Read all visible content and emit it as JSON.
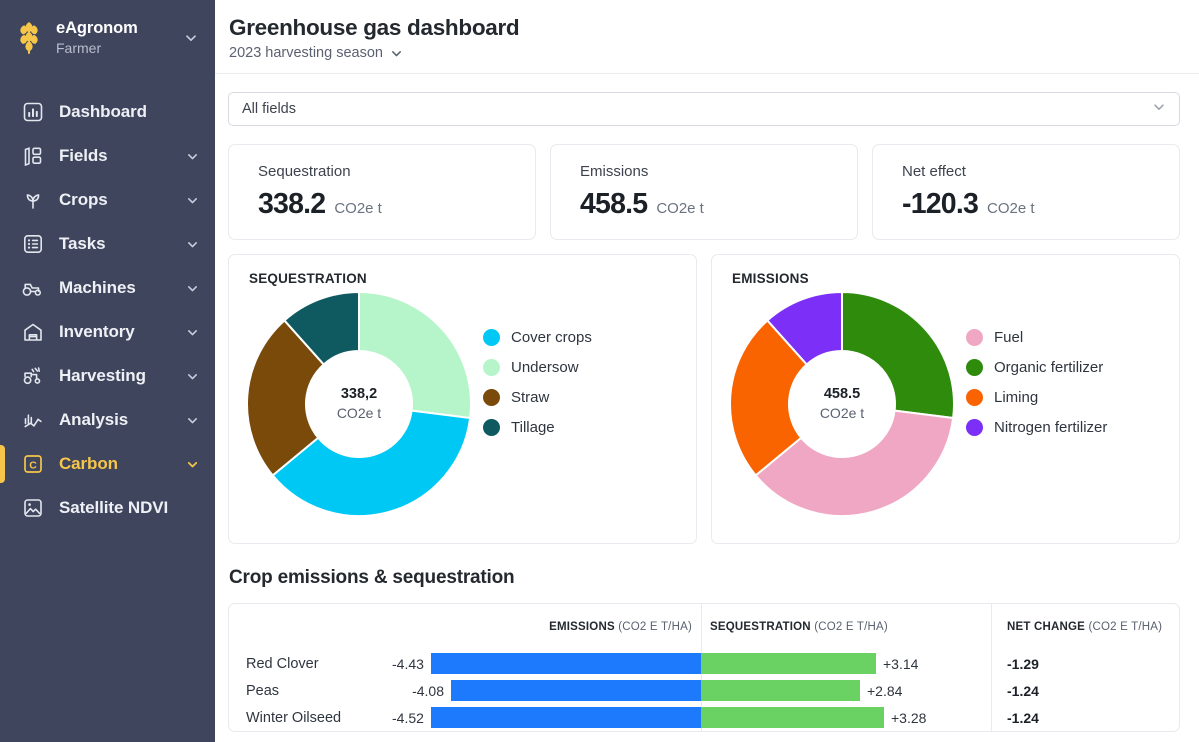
{
  "sidebar": {
    "brand": {
      "name": "eAgronom",
      "role": "Farmer",
      "logo_icon": "wheat-logo-icon",
      "caret_icon": "chevron-down-icon"
    },
    "accent_color": "#f5c64a",
    "background_color": "#3e455c",
    "items": [
      {
        "label": "Dashboard",
        "icon": "bar-chart-icon",
        "caret": false,
        "active": false
      },
      {
        "label": "Fields",
        "icon": "fields-icon",
        "caret": true,
        "active": false
      },
      {
        "label": "Crops",
        "icon": "sprout-icon",
        "caret": true,
        "active": false
      },
      {
        "label": "Tasks",
        "icon": "list-icon",
        "caret": true,
        "active": false
      },
      {
        "label": "Machines",
        "icon": "tractor-icon",
        "caret": true,
        "active": false
      },
      {
        "label": "Inventory",
        "icon": "warehouse-icon",
        "caret": true,
        "active": false
      },
      {
        "label": "Harvesting",
        "icon": "harvester-icon",
        "caret": true,
        "active": false
      },
      {
        "label": "Analysis",
        "icon": "analysis-icon",
        "caret": true,
        "active": false
      },
      {
        "label": "Carbon",
        "icon": "carbon-c-icon",
        "caret": true,
        "active": true
      },
      {
        "label": "Satellite NDVI",
        "icon": "satellite-image-icon",
        "caret": false,
        "active": false
      }
    ]
  },
  "header": {
    "title": "Greenhouse gas dashboard",
    "season": "2023 harvesting season",
    "season_caret_icon": "chevron-down-icon"
  },
  "field_select": {
    "value": "All fields",
    "caret_icon": "chevron-down-icon"
  },
  "stats": [
    {
      "label": "Sequestration",
      "value": "338.2",
      "unit": "CO2e t"
    },
    {
      "label": "Emissions",
      "value": "458.5",
      "unit": "CO2e t"
    },
    {
      "label": "Net effect",
      "value": "-120.3",
      "unit": "CO2e t"
    }
  ],
  "chart_data": [
    {
      "type": "pie",
      "title": "SEQUESTRATION",
      "center_value": "338,2",
      "center_unit": "CO2e t",
      "total": 338.2,
      "legend_position": "right",
      "categories": [
        "Cover crops",
        "Undersow",
        "Straw",
        "Tillage"
      ],
      "values": [
        125.0,
        91.1,
        82.7,
        39.4
      ],
      "percentages": [
        37.0,
        27.0,
        24.4,
        11.6
      ],
      "colors": [
        "#00c8f5",
        "#b5f5c9",
        "#7a4a0b",
        "#0e5a60"
      ],
      "slice_order": [
        "Undersow",
        "Cover crops",
        "Straw",
        "Tillage"
      ]
    },
    {
      "type": "pie",
      "title": "EMISSIONS",
      "center_value": "458.5",
      "center_unit": "CO2e t",
      "total": 458.5,
      "legend_position": "right",
      "categories": [
        "Fuel",
        "Organic fertilizer",
        "Liming",
        "Nitrogen fertilizer"
      ],
      "values": [
        169.4,
        123.5,
        112.1,
        53.5
      ],
      "percentages": [
        37.0,
        27.0,
        24.4,
        11.6
      ],
      "colors": [
        "#f0a7c3",
        "#2e8b0c",
        "#fa6400",
        "#7b2ff7"
      ],
      "slice_order": [
        "Organic fertilizer",
        "Fuel",
        "Liming",
        "Nitrogen fertilizer"
      ]
    },
    {
      "type": "bar",
      "title": "Crop emissions & sequestration",
      "orientation": "horizontal-diverging",
      "columns": [
        "",
        "EMISSIONS",
        "SEQUESTRATION",
        "NET CHANGE"
      ],
      "unit": "(CO2 E T/HA)",
      "categories": [
        "Red Clover",
        "Peas",
        "Winter Oilseed"
      ],
      "series": [
        {
          "name": "EMISSIONS",
          "values": [
            -4.43,
            -4.08,
            -4.52
          ],
          "color": "#1d7afc"
        },
        {
          "name": "SEQUESTRATION",
          "values": [
            3.14,
            2.84,
            3.28
          ],
          "color": "#69d263"
        },
        {
          "name": "NET CHANGE",
          "values": [
            -1.29,
            -1.24,
            -1.24
          ],
          "color": "#1c2128"
        }
      ]
    }
  ],
  "table": {
    "title": "Crop emissions & sequestration",
    "unit_suffix": "(CO2 E T/HA)",
    "headers": {
      "emissions": "EMISSIONS",
      "sequestration": "SEQUESTRATION",
      "net_change": "NET CHANGE"
    },
    "rows": [
      {
        "crop": "Red Clover",
        "emissions": "-4.43",
        "sequestration": "+3.14",
        "net_change": "-1.29",
        "emis_pct": 98.0,
        "seq_pct": 95.7
      },
      {
        "crop": "Peas",
        "emissions": "-4.08",
        "sequestration": "+2.84",
        "net_change": "-1.24",
        "emis_pct": 90.3,
        "seq_pct": 86.6
      },
      {
        "crop": "Winter Oilseed",
        "emissions": "-4.52",
        "sequestration": "+3.28",
        "net_change": "-1.24",
        "emis_pct": 100.0,
        "seq_pct": 100.0
      }
    ]
  }
}
